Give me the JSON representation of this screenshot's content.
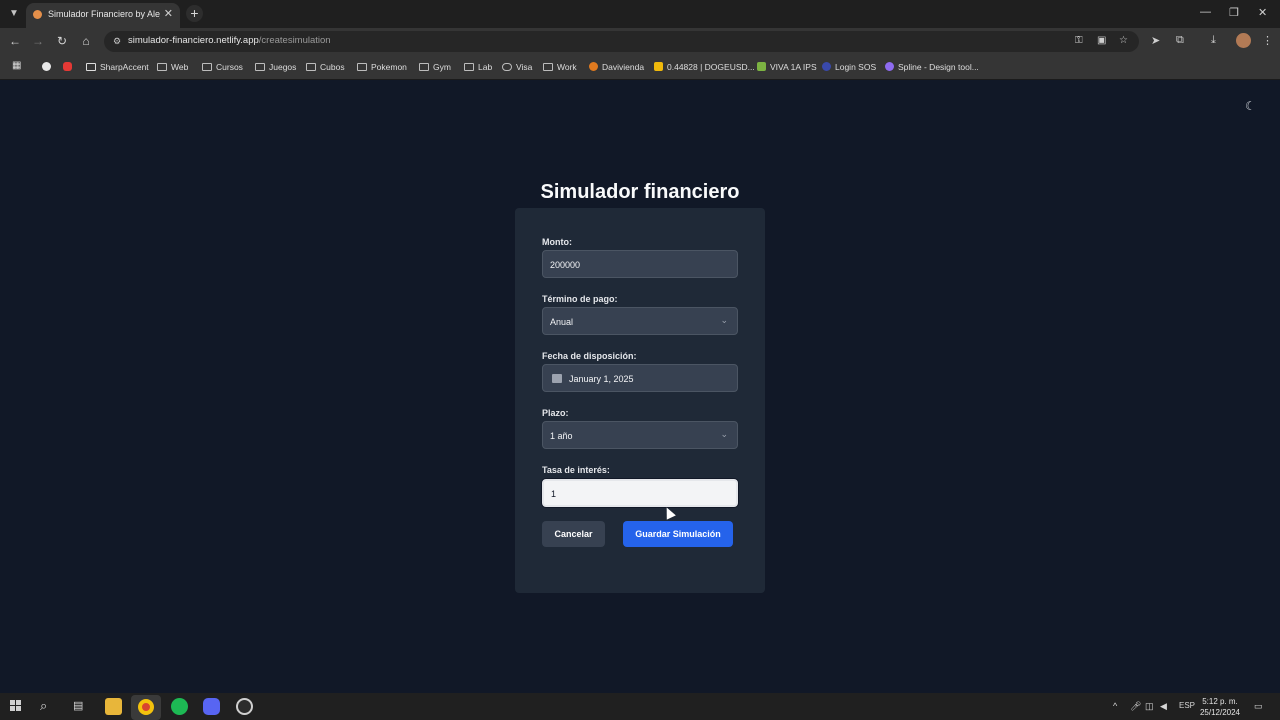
{
  "browser": {
    "tab": {
      "title": "Simulador Financiero by Alejan",
      "close": "✕"
    },
    "new_tab": "+",
    "window_controls": {
      "minimize": "—",
      "maximize": "❐",
      "close": "✕"
    },
    "nav": {
      "back": "←",
      "forward": "→",
      "reload": "↻",
      "home": "⌂"
    },
    "url": {
      "host": "simulador-financiero.netlify.app",
      "path": "/createsimulation"
    },
    "bookmarks": [
      {
        "label": "SharpAccent",
        "icon": "sharpaccent-icon"
      },
      {
        "label": "Web",
        "icon": "folder-icon"
      },
      {
        "label": "Cursos",
        "icon": "folder-icon"
      },
      {
        "label": "Juegos",
        "icon": "folder-icon"
      },
      {
        "label": "Cubos",
        "icon": "folder-icon"
      },
      {
        "label": "Pokemon",
        "icon": "folder-icon"
      },
      {
        "label": "Gym",
        "icon": "folder-icon"
      },
      {
        "label": "Lab",
        "icon": "folder-icon"
      },
      {
        "label": "Visa",
        "icon": "link-icon"
      },
      {
        "label": "Work",
        "icon": "folder-icon"
      },
      {
        "label": "Davivienda",
        "icon": "davivienda-icon"
      },
      {
        "label": "0.44828 | DOGEUSD...",
        "icon": "binance-icon"
      },
      {
        "label": "VIVA 1A IPS",
        "icon": "viva-icon"
      },
      {
        "label": "Login SOS",
        "icon": "sos-icon"
      },
      {
        "label": "Spline - Design tool...",
        "icon": "spline-icon"
      }
    ]
  },
  "page": {
    "title": "Simulador financiero",
    "theme_toggle": "☾",
    "form": {
      "monto": {
        "label": "Monto:",
        "value": "200000"
      },
      "termino": {
        "label": "Término de pago:",
        "value": "Anual"
      },
      "fecha": {
        "label": "Fecha de disposición:",
        "value": "January 1, 2025"
      },
      "plazo": {
        "label": "Plazo:",
        "value": "1 año"
      },
      "tasa": {
        "label": "Tasa de interés:",
        "value": "1"
      },
      "cancel_label": "Cancelar",
      "save_label": "Guardar Simulación"
    }
  },
  "taskbar": {
    "lang": "ESP",
    "time": "5:12 p. m.",
    "date": "25/12/2024"
  },
  "colors": {
    "accent": "#2563eb",
    "card": "#1f2937",
    "background": "#111827"
  }
}
